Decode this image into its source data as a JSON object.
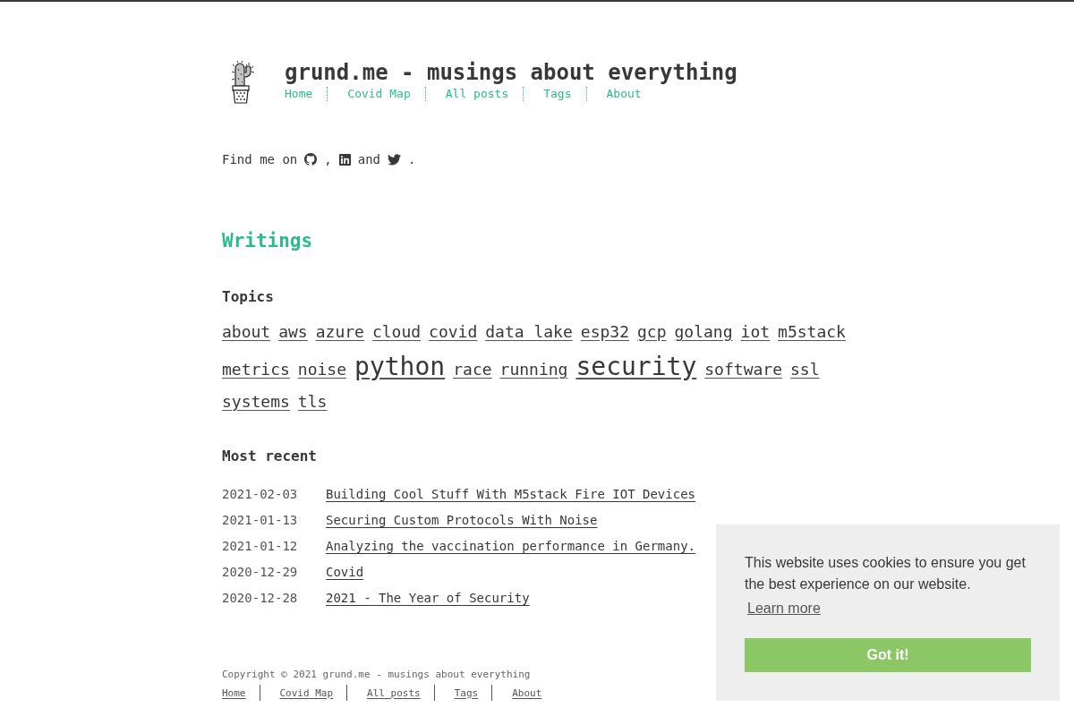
{
  "site": {
    "title": "grund.me - musings about everything"
  },
  "nav": [
    "Home",
    "Covid Map",
    "All posts",
    "Tags",
    "About"
  ],
  "social": [
    "Find me on",
    ",",
    "and",
    "."
  ],
  "writings": {
    "heading": "Writings",
    "topics_heading": "Topics",
    "topics": [
      {
        "label": "about",
        "kind": "regular"
      },
      {
        "label": "aws",
        "kind": "regular"
      },
      {
        "label": "azure",
        "kind": "regular"
      },
      {
        "label": "cloud",
        "kind": "regular"
      },
      {
        "label": "covid",
        "kind": "regular"
      },
      {
        "label": "data lake",
        "kind": "regular"
      },
      {
        "label": "esp32",
        "kind": "regular"
      },
      {
        "label": "gcp",
        "kind": "regular"
      },
      {
        "label": "golang",
        "kind": "regular"
      },
      {
        "label": "iot",
        "kind": "regular"
      },
      {
        "label": "m5stack",
        "kind": "regular"
      },
      {
        "label": "metrics",
        "kind": "regular"
      },
      {
        "label": "noise",
        "kind": "regular"
      },
      {
        "label": "python",
        "kind": "large"
      },
      {
        "label": "race",
        "kind": "regular"
      },
      {
        "label": "running",
        "kind": "regular"
      },
      {
        "label": "security",
        "kind": "large"
      },
      {
        "label": "software",
        "kind": "regular"
      },
      {
        "label": "ssl",
        "kind": "regular"
      },
      {
        "label": "systems",
        "kind": "regular"
      },
      {
        "label": "tls",
        "kind": "regular"
      }
    ],
    "recent_heading": "Most recent",
    "posts": [
      {
        "date": "2021-02-03",
        "title": "Building Cool Stuff With M5stack Fire IOT Devices"
      },
      {
        "date": "2021-01-13",
        "title": "Securing Custom Protocols With Noise"
      },
      {
        "date": "2021-01-12",
        "title": "Analyzing the vaccination performance in Germany."
      },
      {
        "date": "2020-12-29",
        "title": "Covid"
      },
      {
        "date": "2020-12-28",
        "title": "2021 - The Year of Security"
      }
    ]
  },
  "footer": {
    "copyright": "Copyright © 2021 grund.me - musings about everything",
    "links": [
      "Home",
      "Covid Map",
      "All posts",
      "Tags",
      "About"
    ]
  },
  "cookie_banner": {
    "message": "This website uses cookies to ensure you get the best experience on our website.",
    "link": "Learn more",
    "button": "Got it!"
  }
}
